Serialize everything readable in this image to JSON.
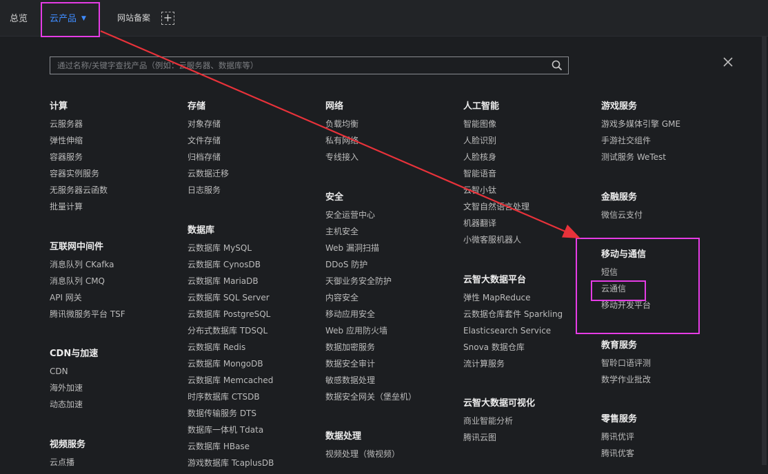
{
  "topbar": {
    "overview": "总览",
    "products": "云产品",
    "beian": "网站备案",
    "add_symbol": "+"
  },
  "search": {
    "placeholder": "通过名称/关键字查找产品（例如：云服务器、数据库等）"
  },
  "colors": {
    "highlight": "#e63ce6",
    "arrow": "#e8323a",
    "accent": "#3f8cff",
    "background": "#1c1e21"
  },
  "icons": {
    "search": "search-icon",
    "close": "close-icon",
    "add": "plus-icon",
    "caret": "caret-down-icon"
  },
  "categories": [
    {
      "title": "计算",
      "items": [
        "云服务器",
        "弹性伸缩",
        "容器服务",
        "容器实例服务",
        "无服务器云函数",
        "批量计算"
      ]
    },
    {
      "title": "互联网中间件",
      "items": [
        "消息队列 CKafka",
        "消息队列 CMQ",
        "API 网关",
        "腾讯微服务平台 TSF"
      ]
    },
    {
      "title": "CDN与加速",
      "items": [
        "CDN",
        "海外加速",
        "动态加速"
      ]
    },
    {
      "title": "视频服务",
      "items": [
        "云点播"
      ]
    },
    {
      "title": "存储",
      "items": [
        "对象存储",
        "文件存储",
        "归档存储",
        "云数据迁移",
        "日志服务"
      ]
    },
    {
      "title": "数据库",
      "items": [
        "云数据库 MySQL",
        "云数据库 CynosDB",
        "云数据库 MariaDB",
        "云数据库 SQL Server",
        "云数据库 PostgreSQL",
        "分布式数据库 TDSQL",
        "云数据库 Redis",
        "云数据库 MongoDB",
        "云数据库 Memcached",
        "时序数据库 CTSDB",
        "数据传输服务 DTS",
        "数据库一体机 Tdata",
        "云数据库 HBase",
        "游戏数据库 TcaplusDB"
      ]
    },
    {
      "title": "网络",
      "items": [
        "负载均衡",
        "私有网络",
        "专线接入"
      ]
    },
    {
      "title": "安全",
      "items": [
        "安全运营中心",
        "主机安全",
        "Web 漏洞扫描",
        "DDoS 防护",
        "天御业务安全防护",
        "内容安全",
        "移动应用安全",
        "Web 应用防火墙",
        "数据加密服务",
        "数据安全审计",
        "敏感数据处理",
        "数据安全网关（堡垒机）"
      ]
    },
    {
      "title": "数据处理",
      "items": [
        "视频处理（微视频）"
      ]
    },
    {
      "title": "人工智能",
      "items": [
        "智能图像",
        "人脸识别",
        "人脸核身",
        "智能语音",
        "云智小钛",
        "文智自然语言处理",
        "机器翻译",
        "小微客服机器人"
      ]
    },
    {
      "title": "云智大数据平台",
      "items": [
        "弹性 MapReduce",
        "云数据仓库套件 Sparkling",
        "Elasticsearch Service",
        "Snova 数据仓库",
        "流计算服务"
      ]
    },
    {
      "title": "云智大数据可视化",
      "items": [
        "商业智能分析",
        "腾讯云图"
      ]
    },
    {
      "title": "游戏服务",
      "items": [
        "游戏多媒体引擎 GME",
        "手游社交组件",
        "测试服务 WeTest"
      ]
    },
    {
      "title": "金融服务",
      "items": [
        "微信云支付"
      ]
    },
    {
      "title": "移动与通信",
      "items": [
        "短信",
        "云通信",
        "移动开发平台"
      ]
    },
    {
      "title": "教育服务",
      "items": [
        "智聆口语评测",
        "数学作业批改"
      ]
    },
    {
      "title": "零售服务",
      "items": [
        "腾讯优评",
        "腾讯优客"
      ]
    }
  ]
}
